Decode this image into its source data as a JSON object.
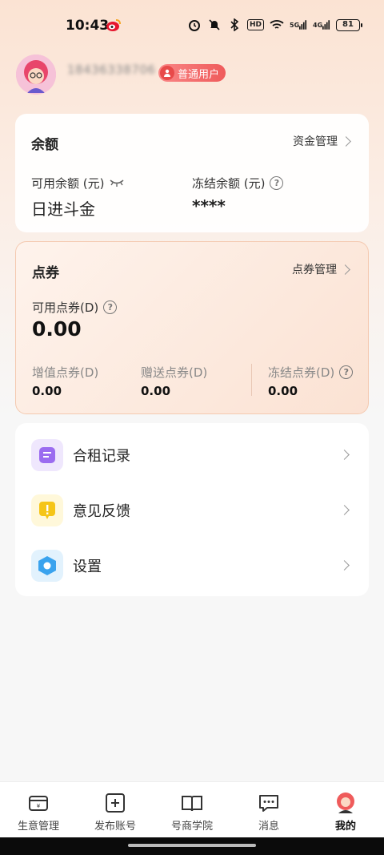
{
  "status_bar": {
    "time": "10:43",
    "hd_label": "HD",
    "sig1_label": "5G",
    "sig2_label": "4G",
    "battery": "81",
    "icons": [
      "weibo-icon",
      "alarm-icon",
      "mute-icon",
      "bluetooth-icon",
      "wifi-icon",
      "signal-icon"
    ]
  },
  "profile": {
    "user_id": "18436338706",
    "badge": "普通用户"
  },
  "balance_card": {
    "title": "余额",
    "link": "资金管理",
    "available_label": "可用余额 (元)",
    "available_value": "日进斗金",
    "frozen_label": "冻结余额 (元)",
    "frozen_value": "****"
  },
  "coupon_card": {
    "title": "点券",
    "link": "点券管理",
    "available_label": "可用点券(D)",
    "available_value": "0.00",
    "stats": [
      {
        "label": "增值点券(D)",
        "value": "0.00"
      },
      {
        "label": "赠送点券(D)",
        "value": "0.00"
      },
      {
        "label": "冻结点券(D)",
        "value": "0.00"
      }
    ]
  },
  "menu": {
    "items": [
      {
        "label": "合租记录",
        "icon": "record-icon",
        "color": "#9b6cf0"
      },
      {
        "label": "意见反馈",
        "icon": "feedback-icon",
        "color": "#f5c518"
      },
      {
        "label": "设置",
        "icon": "settings-icon",
        "color": "#3aa3ee"
      }
    ]
  },
  "tab_bar": {
    "tabs": [
      {
        "label": "生意管理",
        "icon": "business-icon"
      },
      {
        "label": "发布账号",
        "icon": "publish-icon"
      },
      {
        "label": "号商学院",
        "icon": "academy-icon"
      },
      {
        "label": "消息",
        "icon": "message-icon"
      },
      {
        "label": "我的",
        "icon": "profile-icon",
        "active": true
      }
    ]
  },
  "colors": {
    "accent_red": "#ef5b5b",
    "coupon_border": "#f4c9b0"
  }
}
